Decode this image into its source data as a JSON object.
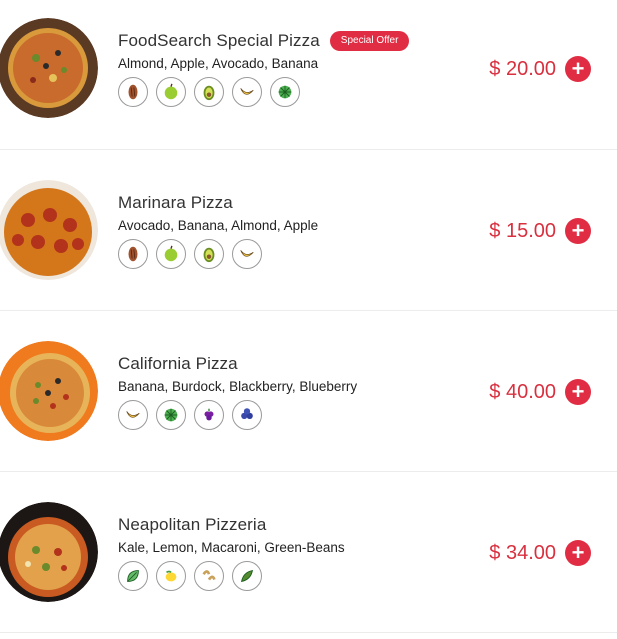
{
  "items": [
    {
      "name": "FoodSearch Special Pizza",
      "badge": "Special Offer",
      "ingredients": "Almond, Apple, Avocado, Banana",
      "icons": [
        "almond-icon",
        "apple-icon",
        "avocado-icon",
        "banana-icon",
        "burdock-icon"
      ],
      "price": "$ 20.00",
      "add": "+"
    },
    {
      "name": "Marinara Pizza",
      "ingredients": "Avocado, Banana, Almond, Apple",
      "icons": [
        "almond-icon",
        "apple-icon",
        "avocado-icon",
        "banana-icon"
      ],
      "price": "$ 15.00",
      "add": "+"
    },
    {
      "name": "California Pizza",
      "ingredients": "Banana, Burdock, Blackberry, Blueberry",
      "icons": [
        "banana-icon",
        "burdock-icon",
        "blackberry-icon",
        "blueberry-icon"
      ],
      "price": "$ 40.00",
      "add": "+"
    },
    {
      "name": "Neapolitan Pizzeria",
      "ingredients": "Kale, Lemon, Macaroni, Green-Beans",
      "icons": [
        "kale-icon",
        "lemon-icon",
        "macaroni-icon",
        "green-beans-icon"
      ],
      "price": "$ 34.00",
      "add": "+"
    }
  ],
  "colors": {
    "accent": "#e02d43",
    "price": "#d8303f"
  }
}
